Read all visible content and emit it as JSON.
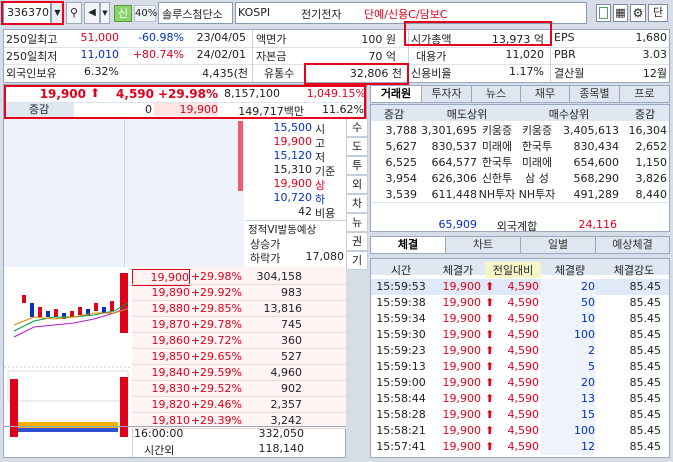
{
  "toolbar": {
    "code": "336370",
    "market_flag": "신",
    "margin": "40%",
    "stock_name": "솔루스첨단소",
    "exchange": "KOSPI",
    "sector": "전기전자",
    "tags": "단예/신용C/담보C",
    "btn_single": "단"
  },
  "info": [
    [
      "250일최고",
      "51,000",
      "-60.98%",
      "23/04/05",
      "액면가",
      "100 원",
      "시가총액",
      "13,973 억",
      "EPS",
      "1,680"
    ],
    [
      "250일최저",
      "11,010",
      "+80.74%",
      "24/02/01",
      "자본금",
      "70 억",
      "대용가",
      "11,020",
      "PBR",
      "3.03"
    ],
    [
      "외국인보유",
      "6.32%",
      "4,435(천",
      "",
      "유통수",
      "32,806 천",
      "신용비율",
      "1.17%",
      "결산월",
      "12월"
    ]
  ],
  "price": {
    "current": "19,900",
    "change": "4,590",
    "rate": "+29.98%",
    "volume": "8,157,100",
    "prev_vol": "1,049.15%",
    "label_change": "증감",
    "change_qty": "0",
    "amt_price": "19,900",
    "amount": "149,717백만",
    "turnover": "11.62%"
  },
  "summary": [
    {
      "value": "15,500",
      "label": "시"
    },
    {
      "value": "19,900",
      "label": "고"
    },
    {
      "value": "15,120",
      "label": "저"
    },
    {
      "value": "15,310",
      "label": "기준"
    },
    {
      "value": "19,900",
      "label": "상"
    },
    {
      "value": "10,720",
      "label": "하"
    },
    {
      "value": "42",
      "label": "비용"
    }
  ],
  "vi": {
    "title": "정적VI발동예상",
    "up": "상승가",
    "down": "하락가",
    "down_value": "17,080"
  },
  "side_buttons": [
    "수",
    "도",
    "투",
    "외",
    "차",
    "뉴",
    "권",
    "기"
  ],
  "bids": [
    [
      "19,900",
      "+29.98%",
      "304,158"
    ],
    [
      "19,890",
      "+29.92%",
      "983"
    ],
    [
      "19,880",
      "+29.85%",
      "13,816"
    ],
    [
      "19,870",
      "+29.78%",
      "745"
    ],
    [
      "19,860",
      "+29.72%",
      "360"
    ],
    [
      "19,850",
      "+29.65%",
      "527"
    ],
    [
      "19,840",
      "+29.59%",
      "4,960"
    ],
    [
      "19,830",
      "+29.52%",
      "902"
    ],
    [
      "19,820",
      "+29.46%",
      "2,357"
    ],
    [
      "19,810",
      "+29.39%",
      "3,242"
    ]
  ],
  "bottom": {
    "time": "16:00:00",
    "ask_total": "332,050",
    "after_label": "시간외",
    "after_value": "118,140"
  },
  "top_tabs": [
    "거래원",
    "투자자",
    "뉴스",
    "재무",
    "종목별",
    "프로"
  ],
  "broker": {
    "headers": [
      "증감",
      "매도상위",
      "매수상위",
      "증감"
    ],
    "rows": [
      [
        "3,788",
        "3,301,695",
        "키움증",
        "키움증",
        "3,405,613",
        "16,304"
      ],
      [
        "5,627",
        "830,537",
        "미래에",
        "한국투",
        "830,434",
        "2,652"
      ],
      [
        "6,525",
        "664,577",
        "한국투",
        "미래에",
        "654,600",
        "1,150"
      ],
      [
        "3,954",
        "626,306",
        "신한투",
        "삼 성",
        "568,290",
        "3,826"
      ],
      [
        "3,539",
        "611,448",
        "NH투자",
        "NH투자",
        "491,289",
        "8,440"
      ]
    ],
    "foreign_sell": "65,909",
    "foreign_label": "외국계합",
    "foreign_buy": "24,116"
  },
  "bottom_tabs": [
    "체결",
    "차트",
    "일별",
    "예상체결"
  ],
  "ticks": {
    "headers": [
      "시간",
      "체결가",
      "전일대비",
      "체결량",
      "체결강도"
    ],
    "rows": [
      [
        "15:59:53",
        "19,900",
        "4,590",
        "20",
        "85.45"
      ],
      [
        "15:59:38",
        "19,900",
        "4,590",
        "50",
        "85.45"
      ],
      [
        "15:59:34",
        "19,900",
        "4,590",
        "10",
        "85.45"
      ],
      [
        "15:59:30",
        "19,900",
        "4,590",
        "100",
        "85.45"
      ],
      [
        "15:59:23",
        "19,900",
        "4,590",
        "2",
        "85.45"
      ],
      [
        "15:59:13",
        "19,900",
        "4,590",
        "5",
        "85.45"
      ],
      [
        "15:59:00",
        "19,900",
        "4,590",
        "20",
        "85.45"
      ],
      [
        "15:58:44",
        "19,900",
        "4,590",
        "13",
        "85.45"
      ],
      [
        "15:58:28",
        "19,900",
        "4,590",
        "15",
        "85.45"
      ],
      [
        "15:58:21",
        "19,900",
        "4,590",
        "100",
        "85.45"
      ],
      [
        "15:57:41",
        "19,900",
        "4,590",
        "12",
        "85.45"
      ]
    ]
  },
  "colors": {
    "rise": "#e0001b",
    "fall": "#0030c8",
    "highlight": "#e8001c"
  }
}
